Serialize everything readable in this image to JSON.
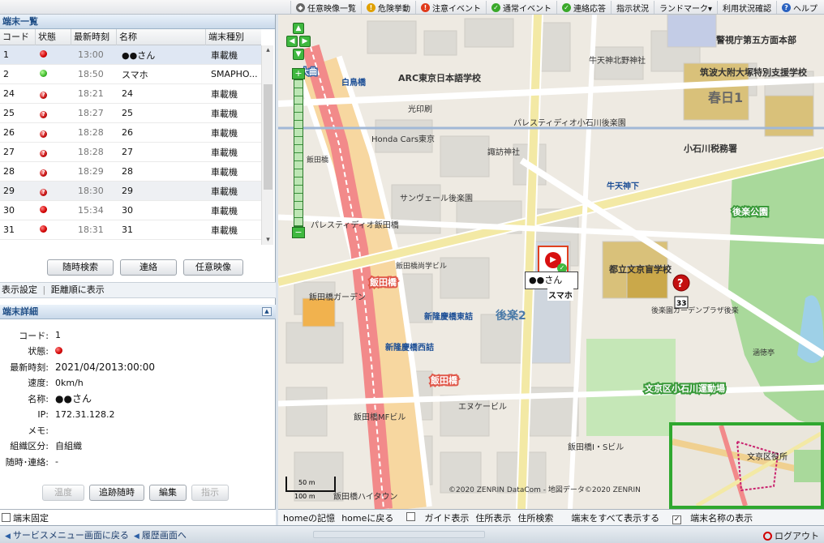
{
  "topmenu": [
    {
      "label": "任意映像一覧",
      "icon": "camera-icon",
      "color": "#666666"
    },
    {
      "label": "危険挙動",
      "icon": "warning-icon",
      "color": "#e0a000"
    },
    {
      "label": "注意イベント",
      "icon": "alert-icon",
      "color": "#e03a1a"
    },
    {
      "label": "通常イベント",
      "icon": "check-icon",
      "color": "#3aa82a"
    },
    {
      "label": "連絡応答",
      "icon": "check-icon",
      "color": "#3aa82a"
    },
    {
      "label": "指示状況",
      "icon": "",
      "color": ""
    },
    {
      "label": "ランドマーク▾",
      "icon": "",
      "color": ""
    },
    {
      "label": "利用状況確認",
      "icon": "",
      "color": ""
    },
    {
      "label": "ヘルプ",
      "icon": "help-icon",
      "color": "#2a62c0"
    }
  ],
  "terminal_list": {
    "title": "端末一覧",
    "columns": [
      "コード",
      "状態",
      "最新時刻",
      "名称",
      "端末種別"
    ],
    "rows": [
      {
        "code": "1",
        "status": "red",
        "time": "13:00",
        "name": "●●さん",
        "type": "車載機"
      },
      {
        "code": "2",
        "status": "green",
        "time": "18:50",
        "name": "スマホ",
        "type": "SMAPHO..."
      },
      {
        "code": "24",
        "status": "question",
        "time": "18:21",
        "name": "24",
        "type": "車載機"
      },
      {
        "code": "25",
        "status": "question",
        "time": "18:27",
        "name": "25",
        "type": "車載機"
      },
      {
        "code": "26",
        "status": "question",
        "time": "18:28",
        "name": "26",
        "type": "車載機"
      },
      {
        "code": "27",
        "status": "question",
        "time": "18:28",
        "name": "27",
        "type": "車載機"
      },
      {
        "code": "28",
        "status": "question",
        "time": "18:29",
        "name": "28",
        "type": "車載機"
      },
      {
        "code": "29",
        "status": "question",
        "time": "18:30",
        "name": "29",
        "type": "車載機"
      },
      {
        "code": "30",
        "status": "red",
        "time": "15:34",
        "name": "30",
        "type": "車載機"
      },
      {
        "code": "31",
        "status": "red",
        "time": "18:31",
        "name": "31",
        "type": "車載機"
      }
    ],
    "buttons": [
      "随時検索",
      "連絡",
      "任意映像"
    ]
  },
  "links": [
    "表示設定",
    "距離順に表示"
  ],
  "detail": {
    "title": "端末詳細",
    "code_label": "コード:",
    "code": "1",
    "status_label": "状態:",
    "time_label": "最新時刻:",
    "time": "2021/04/2013:00:00",
    "speed_label": "速度:",
    "speed": "0km/h",
    "name_label": "名称:",
    "name": "●●さん",
    "ip_label": "IP:",
    "ip": "172.31.128.2",
    "memo_label": "メモ:",
    "memo": "",
    "group_label": "組織区分:",
    "group": "自組織",
    "contact_label": "随時･連絡:",
    "contact": "-",
    "buttons": [
      "温度",
      "追跡随時",
      "編集",
      "指示"
    ]
  },
  "left_footer": {
    "fix_label": "端末固定"
  },
  "map": {
    "labels": {
      "l1": "大曲",
      "l2": "白鳥橋",
      "l3": "ARC東京日本語学校",
      "l4": "牛天神北野神社",
      "l5": "筑波大附大塚特別支援学校",
      "l6": "警視庁第五方面本部",
      "l7": "春日1",
      "l8": "光印刷",
      "l9": "パレスティディオ小石川後楽園",
      "l10": "小石川税務署",
      "l11": "Honda Cars東京",
      "l12": "諏訪神社",
      "l13": "飯田橋",
      "l14": "牛天神下",
      "l15": "後楽公園",
      "l16": "サンヴェール後楽園",
      "l17": "パレスティディオ飯田橋",
      "l18": "飯田橋",
      "l19": "都立文京盲学校",
      "l20": "後楽2",
      "l21": "新隆慶橋東詰",
      "l22": "新隆慶橋西詰",
      "l23": "飯田橋ガーデン",
      "l24": "飯田橋",
      "l25": "文京区小石川運動場",
      "l26": "飯田橋MFビル",
      "l27": "エヌケービル",
      "l28": "飯田橋ハイタウン",
      "l29": "飯田橋I・Sビル",
      "l30": "文京区役所",
      "l31": "後楽園ガーデンプラザ後楽",
      "l32": "涵徳亭",
      "l33": "飯田橋尚学ビル"
    },
    "copyright": "©2020 ZENRIN DataCom - 地図データ©2020 ZENRIN",
    "scale_top": "50 m",
    "scale_bottom": "100 m",
    "vehicle_label": "●●さん",
    "phone_label": "スマホ",
    "route_num": "33"
  },
  "map_footer": {
    "home_memo": "homeの記憶",
    "home_back": "homeに戻る",
    "guide": "ガイド表示",
    "address_show": "住所表示",
    "address_search": "住所検索",
    "show_all": "端末をすべて表示する",
    "show_names": "端末名称の表示"
  },
  "bottom": {
    "back_service": "サービスメニュー画面に戻る",
    "history": "履歴画面へ",
    "logout": "ログアウト"
  }
}
